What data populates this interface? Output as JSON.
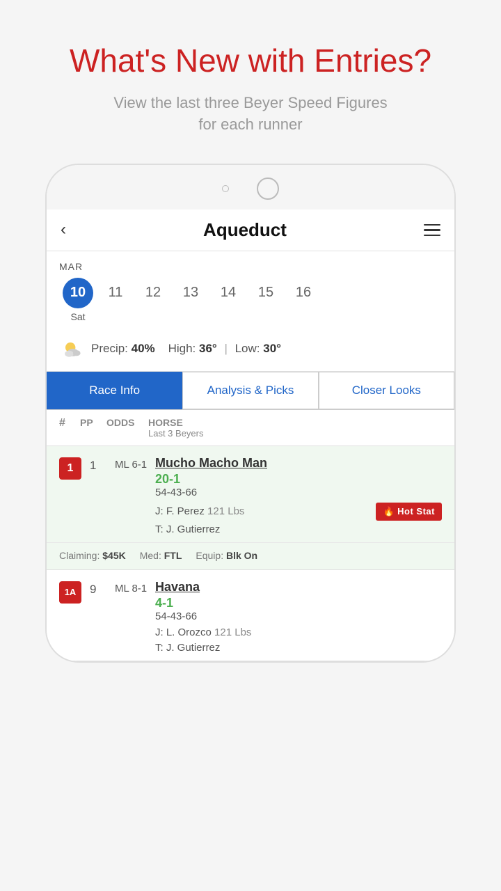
{
  "page": {
    "header": {
      "title": "What's New with Entries?",
      "subtitle": "View the last three Beyer Speed Figures\nfor each runner"
    },
    "navbar": {
      "back_label": "‹",
      "app_title": "Aqueduct",
      "menu_icon": "hamburger"
    },
    "date_strip": {
      "month": "MAR",
      "dates": [
        "10",
        "11",
        "12",
        "13",
        "14",
        "15",
        "16"
      ],
      "active_date": "10",
      "day_label": "Sat"
    },
    "weather": {
      "precip_label": "Precip:",
      "precip_value": "40%",
      "high_label": "High:",
      "high_value": "36",
      "separator": "|",
      "low_label": "Low:",
      "low_value": "30"
    },
    "tabs": [
      {
        "id": "race-info",
        "label": "Race Info",
        "active": true
      },
      {
        "id": "analysis-picks",
        "label": "Analysis & Picks",
        "active": false
      },
      {
        "id": "closer-looks",
        "label": "Closer Looks",
        "active": false
      }
    ],
    "table_header": {
      "hash": "#",
      "pp": "PP",
      "odds": "ODDS",
      "horse": "HORSE",
      "beyers": "Last 3 Beyers"
    },
    "entries": [
      {
        "badge": "1",
        "badge_color": "#cc2222",
        "pp": "1",
        "odds_label": "ML 6-1",
        "odds_value": "20-1",
        "odds_color": "#4caf50",
        "horse_name": "Mucho Macho Man",
        "beyers": "54-43-66",
        "jockey": "J: F. Perez",
        "jockey_lbs": "121 Lbs",
        "trainer": "T: J. Gutierrez",
        "hot_stat": true,
        "hot_stat_label": "Hot Stat",
        "claiming": "$45K",
        "med": "FTL",
        "equip": "Blk On",
        "row_bg": "green"
      },
      {
        "badge": "1A",
        "badge_color": "#cc2222",
        "pp": "9",
        "odds_label": "ML 8-1",
        "odds_value": "4-1",
        "odds_color": "#4caf50",
        "horse_name": "Havana",
        "beyers": "54-43-66",
        "jockey": "J: L. Orozco",
        "jockey_lbs": "121 Lbs",
        "trainer": "T: J. Gutierrez",
        "hot_stat": false,
        "row_bg": "white"
      }
    ]
  }
}
